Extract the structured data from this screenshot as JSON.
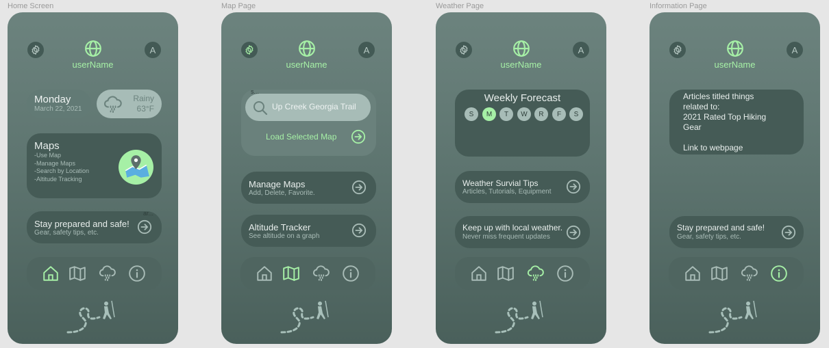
{
  "colors": {
    "accent": "#a6f0a6",
    "card": "#455b56",
    "phone_top": "#6c837e",
    "phone_bottom": "#4a605b"
  },
  "frames": [
    {
      "label": "Home Screen"
    },
    {
      "label": "Map Page"
    },
    {
      "label": "Weather Page"
    },
    {
      "label": "Information Page"
    }
  ],
  "header": {
    "username": "userName",
    "avatar_letter": "A"
  },
  "home": {
    "date_day": "Monday",
    "date_full": "March 22, 2021",
    "weather_condition": "Rainy",
    "weather_temp": "63°F",
    "maps_title": "Maps",
    "maps_items": [
      "-Use Map",
      "-Manage Maps",
      "-Search by Location",
      "-Altitude Tracking"
    ],
    "stay_title": "Stay prepared and safe!",
    "stay_sub": "Gear, safety tips, etc.",
    "stay_overflow": "ar..."
  },
  "map": {
    "search_label": "s...",
    "search_value": "Up Creek Georgia Trail",
    "load_button": "Load Selected Map",
    "manage_title": "Manage Maps",
    "manage_sub": "Add, Delete, Favorite.",
    "altitude_title": "Altitude Tracker",
    "altitude_sub": "See altitude on a graph"
  },
  "weather": {
    "forecast_title": "Weekly Forecast",
    "days": [
      "S",
      "M",
      "T",
      "W",
      "R",
      "F",
      "S"
    ],
    "active_day_index": 1,
    "tips_title": "Weather Survial Tips",
    "tips_sub": "Articles, Tutorials, Equipment",
    "local_title": "Keep up with  local weather.",
    "local_sub": "Never miss frequent updates"
  },
  "info": {
    "article_line1": "Articles titled things",
    "article_line2": "related to:",
    "article_line3": "2021 Rated Top Hiking",
    "article_line4": "Gear",
    "article_link": "Link to webpage",
    "stay_title": "Stay prepared and safe!",
    "stay_sub": "Gear, safety tips, etc."
  },
  "nav": {
    "items": [
      "home",
      "map",
      "weather",
      "info"
    ]
  }
}
